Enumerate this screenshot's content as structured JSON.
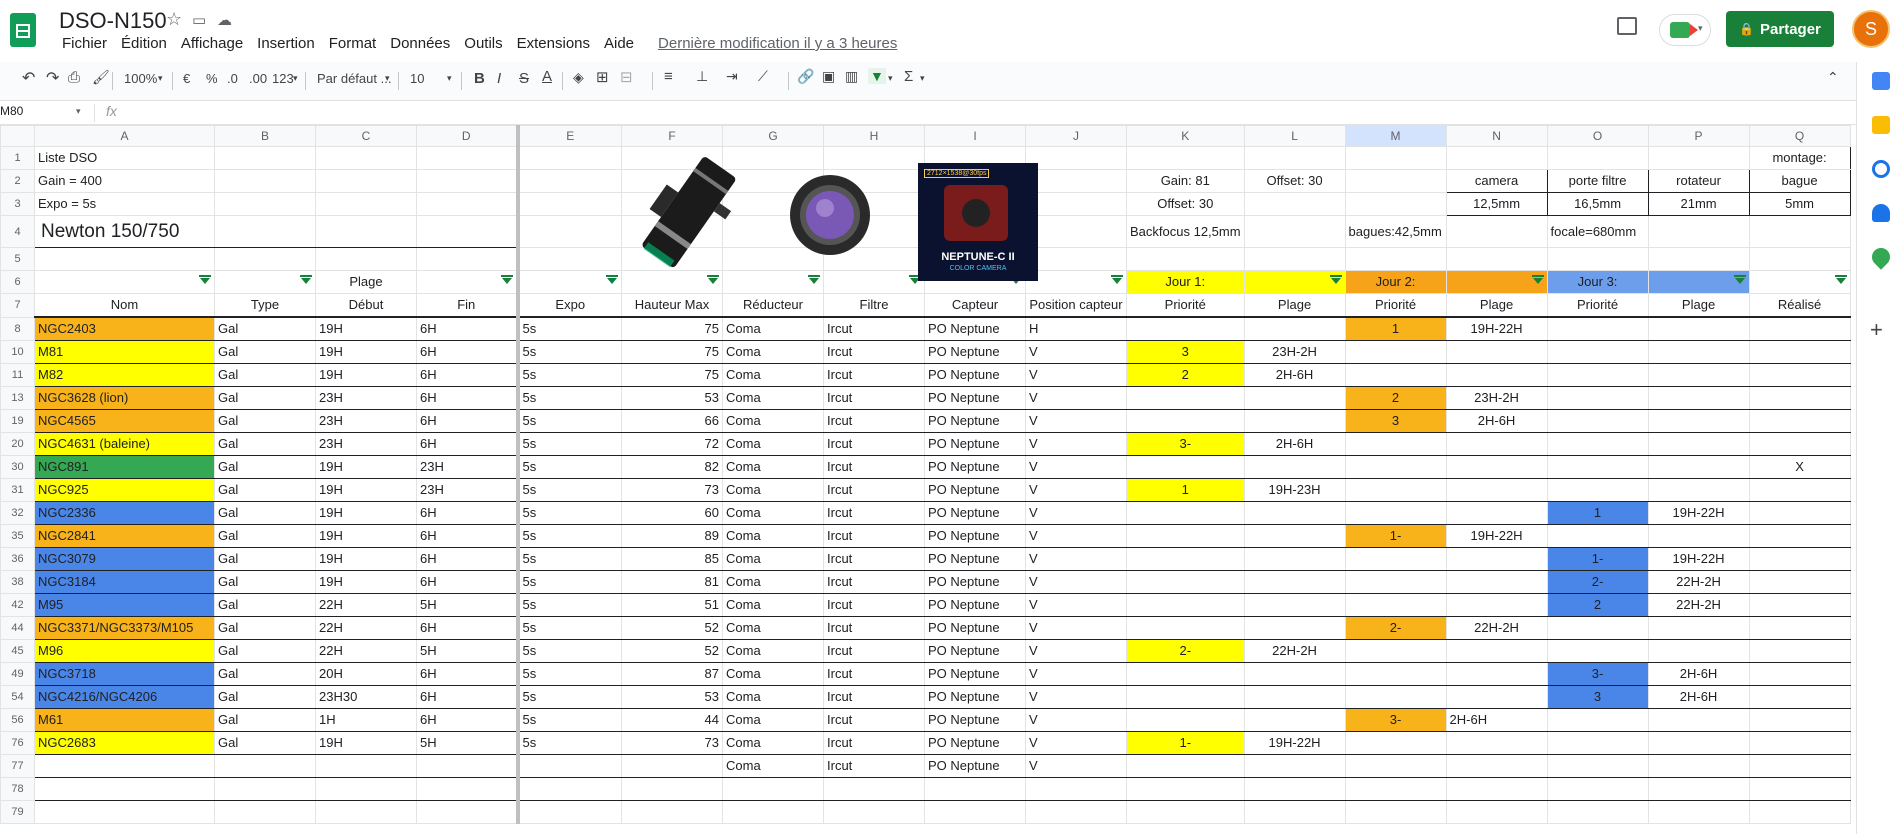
{
  "doc": {
    "title": "DSO-N150",
    "menus": [
      "Fichier",
      "Édition",
      "Affichage",
      "Insertion",
      "Format",
      "Données",
      "Outils",
      "Extensions",
      "Aide"
    ],
    "last_edit": "Dernière modification il y a 3 heures",
    "share_label": "Partager",
    "avatar_letter": "S"
  },
  "toolbar": {
    "zoom": "100%",
    "currency": "€",
    "percent": "%",
    "dec_less": ".0",
    "dec_more": ".00",
    "number_format": "123",
    "font": "Par défaut ...",
    "font_size": "10"
  },
  "formula": {
    "cell_ref": "M80",
    "fx": "fx"
  },
  "colors": {
    "brand": "#188038",
    "yellow": "#ffff00",
    "orange": "#f9b31a",
    "green": "#34a853",
    "blue": "#4a86e8"
  },
  "columns": [
    "A",
    "B",
    "C",
    "D",
    "E",
    "F",
    "G",
    "H",
    "I",
    "J",
    "K",
    "L",
    "M",
    "N",
    "O",
    "P",
    "Q"
  ],
  "header_rows": {
    "r1_a": "Liste DSO",
    "r1_q": "montage:",
    "r2_a": "Gain = 400",
    "r2_k": "Gain: 81",
    "r2_l": "Offset: 30",
    "r2_n": "camera",
    "r2_o": "porte filtre",
    "r2_p": "rotateur",
    "r2_q": "bague",
    "r3_a": "Expo = 5s",
    "r3_k": "Offset: 30",
    "r3_n": "12,5mm",
    "r3_o": "16,5mm",
    "r3_p": "21mm",
    "r3_q": "5mm",
    "r4_a": "Newton 150/750",
    "r4_k": "Backfocus 12,5mm",
    "r4_m": "bagues:42,5mm",
    "r4_o": "focale=680mm",
    "r6_c": "Plage",
    "r6_k": "Jour 1:",
    "r6_m": "Jour 2:",
    "r6_o": "Jour 3:",
    "r7": [
      "Nom",
      "Type",
      "Début",
      "Fin",
      "Expo",
      "Hauteur Max",
      "Réducteur",
      "Filtre",
      "Capteur",
      "Position capteur",
      "Priorité",
      "Plage",
      "Priorité",
      "Plage",
      "Priorité",
      "Plage",
      "Réalisé"
    ]
  },
  "rows": [
    {
      "n": "8",
      "name": "NGC2403",
      "type": "Gal",
      "start": "19H",
      "end": "6H",
      "expo": "5s",
      "hmax": "75",
      "red": "Coma",
      "filter": "Ircut",
      "cap": "PO Neptune",
      "pos": "H",
      "p1": "",
      "r1": "",
      "p2": "1",
      "r2": "19H-22H",
      "p3": "",
      "r3": "",
      "done": ""
    },
    {
      "n": "10",
      "name": "M81",
      "type": "Gal",
      "start": "19H",
      "end": "6H",
      "expo": "5s",
      "hmax": "75",
      "red": "Coma",
      "filter": "Ircut",
      "cap": "PO Neptune",
      "pos": "V",
      "p1": "3",
      "r1": "23H-2H",
      "p2": "",
      "r2": "",
      "p3": "",
      "r3": "",
      "done": ""
    },
    {
      "n": "11",
      "name": "M82",
      "type": "Gal",
      "start": "19H",
      "end": "6H",
      "expo": "5s",
      "hmax": "75",
      "red": "Coma",
      "filter": "Ircut",
      "cap": "PO Neptune",
      "pos": "V",
      "p1": "2",
      "r1": "2H-6H",
      "p2": "",
      "r2": "",
      "p3": "",
      "r3": "",
      "done": ""
    },
    {
      "n": "13",
      "name": "NGC3628 (lion)",
      "type": "Gal",
      "start": "23H",
      "end": "6H",
      "expo": "5s",
      "hmax": "53",
      "red": "Coma",
      "filter": "Ircut",
      "cap": "PO Neptune",
      "pos": "V",
      "p1": "",
      "r1": "",
      "p2": "2",
      "r2": "23H-2H",
      "p3": "",
      "r3": "",
      "done": ""
    },
    {
      "n": "19",
      "name": "NGC4565",
      "type": "Gal",
      "start": "23H",
      "end": "6H",
      "expo": "5s",
      "hmax": "66",
      "red": "Coma",
      "filter": "Ircut",
      "cap": "PO Neptune",
      "pos": "V",
      "p1": "",
      "r1": "",
      "p2": "3",
      "r2": "2H-6H",
      "p3": "",
      "r3": "",
      "done": ""
    },
    {
      "n": "20",
      "name": "NGC4631 (baleine)",
      "type": "Gal",
      "start": "23H",
      "end": "6H",
      "expo": "5s",
      "hmax": "72",
      "red": "Coma",
      "filter": "Ircut",
      "cap": "PO Neptune",
      "pos": "V",
      "p1": "3-",
      "r1": "2H-6H",
      "p2": "",
      "r2": "",
      "p3": "",
      "r3": "",
      "done": ""
    },
    {
      "n": "30",
      "name": "NGC891",
      "type": "Gal",
      "start": "19H",
      "end": "23H",
      "expo": "5s",
      "hmax": "82",
      "red": "Coma",
      "filter": "Ircut",
      "cap": "PO Neptune",
      "pos": "V",
      "p1": "",
      "r1": "",
      "p2": "",
      "r2": "",
      "p3": "",
      "r3": "",
      "done": "X"
    },
    {
      "n": "31",
      "name": "NGC925",
      "type": "Gal",
      "start": "19H",
      "end": "23H",
      "expo": "5s",
      "hmax": "73",
      "red": "Coma",
      "filter": "Ircut",
      "cap": "PO Neptune",
      "pos": "V",
      "p1": "1",
      "r1": "19H-23H",
      "p2": "",
      "r2": "",
      "p3": "",
      "r3": "",
      "done": ""
    },
    {
      "n": "32",
      "name": "NGC2336",
      "type": "Gal",
      "start": "19H",
      "end": "6H",
      "expo": "5s",
      "hmax": "60",
      "red": "Coma",
      "filter": "Ircut",
      "cap": "PO Neptune",
      "pos": "V",
      "p1": "",
      "r1": "",
      "p2": "",
      "r2": "",
      "p3": "1",
      "r3": "19H-22H",
      "done": ""
    },
    {
      "n": "35",
      "name": "NGC2841",
      "type": "Gal",
      "start": "19H",
      "end": "6H",
      "expo": "5s",
      "hmax": "89",
      "red": "Coma",
      "filter": "Ircut",
      "cap": "PO Neptune",
      "pos": "V",
      "p1": "",
      "r1": "",
      "p2": "1-",
      "r2": "19H-22H",
      "p3": "",
      "r3": "",
      "done": ""
    },
    {
      "n": "36",
      "name": "NGC3079",
      "type": "Gal",
      "start": "19H",
      "end": "6H",
      "expo": "5s",
      "hmax": "85",
      "red": "Coma",
      "filter": "Ircut",
      "cap": "PO Neptune",
      "pos": "V",
      "p1": "",
      "r1": "",
      "p2": "",
      "r2": "",
      "p3": "1-",
      "r3": "19H-22H",
      "done": ""
    },
    {
      "n": "38",
      "name": "NGC3184",
      "type": "Gal",
      "start": "19H",
      "end": "6H",
      "expo": "5s",
      "hmax": "81",
      "red": "Coma",
      "filter": "Ircut",
      "cap": "PO Neptune",
      "pos": "V",
      "p1": "",
      "r1": "",
      "p2": "",
      "r2": "",
      "p3": "2-",
      "r3": "22H-2H",
      "done": ""
    },
    {
      "n": "42",
      "name": "M95",
      "type": "Gal",
      "start": "22H",
      "end": "5H",
      "expo": "5s",
      "hmax": "51",
      "red": "Coma",
      "filter": "Ircut",
      "cap": "PO Neptune",
      "pos": "V",
      "p1": "",
      "r1": "",
      "p2": "",
      "r2": "",
      "p3": "2",
      "r3": "22H-2H",
      "done": ""
    },
    {
      "n": "44",
      "name": "NGC3371/NGC3373/M105",
      "type": "Gal",
      "start": "22H",
      "end": "6H",
      "expo": "5s",
      "hmax": "52",
      "red": "Coma",
      "filter": "Ircut",
      "cap": "PO Neptune",
      "pos": "V",
      "p1": "",
      "r1": "",
      "p2": "2-",
      "r2": "22H-2H",
      "p3": "",
      "r3": "",
      "done": ""
    },
    {
      "n": "45",
      "name": "M96",
      "type": "Gal",
      "start": "22H",
      "end": "5H",
      "expo": "5s",
      "hmax": "52",
      "red": "Coma",
      "filter": "Ircut",
      "cap": "PO Neptune",
      "pos": "V",
      "p1": "2-",
      "r1": "22H-2H",
      "p2": "",
      "r2": "",
      "p3": "",
      "r3": "",
      "done": ""
    },
    {
      "n": "49",
      "name": "NGC3718",
      "type": "Gal",
      "start": "20H",
      "end": "6H",
      "expo": "5s",
      "hmax": "87",
      "red": "Coma",
      "filter": "Ircut",
      "cap": "PO Neptune",
      "pos": "V",
      "p1": "",
      "r1": "",
      "p2": "",
      "r2": "",
      "p3": "3-",
      "r3": "2H-6H",
      "done": ""
    },
    {
      "n": "54",
      "name": "NGC4216/NGC4206",
      "type": "Gal",
      "start": "23H30",
      "end": "6H",
      "expo": "5s",
      "hmax": "53",
      "red": "Coma",
      "filter": "Ircut",
      "cap": "PO Neptune",
      "pos": "V",
      "p1": "",
      "r1": "",
      "p2": "",
      "r2": "",
      "p3": "3",
      "r3": "2H-6H",
      "done": ""
    },
    {
      "n": "56",
      "name": "M61",
      "type": "Gal",
      "start": "1H",
      "end": "6H",
      "expo": "5s",
      "hmax": "44",
      "red": "Coma",
      "filter": "Ircut",
      "cap": "PO Neptune",
      "pos": "V",
      "p1": "",
      "r1": "",
      "p2": "3-",
      "r2": "2H-6H",
      "p3": "",
      "r3": "",
      "done": ""
    },
    {
      "n": "76",
      "name": "NGC2683",
      "type": "Gal",
      "start": "19H",
      "end": "5H",
      "expo": "5s",
      "hmax": "73",
      "red": "Coma",
      "filter": "Ircut",
      "cap": "PO Neptune",
      "pos": "V",
      "p1": "1-",
      "r1": "19H-22H",
      "p2": "",
      "r2": "",
      "p3": "",
      "r3": "",
      "done": ""
    },
    {
      "n": "77",
      "name": "",
      "type": "",
      "start": "",
      "end": "",
      "expo": "",
      "hmax": "",
      "red": "Coma",
      "filter": "Ircut",
      "cap": "PO Neptune",
      "pos": "V",
      "p1": "",
      "r1": "",
      "p2": "",
      "r2": "",
      "p3": "",
      "r3": "",
      "done": ""
    }
  ],
  "name_colors": [
    "orange",
    "yellow",
    "yellow",
    "orange",
    "orange",
    "yellow",
    "green",
    "yellow",
    "blue",
    "orange",
    "blue",
    "blue",
    "blue",
    "orange",
    "yellow",
    "blue",
    "blue",
    "orange",
    "yellow",
    ""
  ],
  "images": {
    "camera_label": "NEPTUNE-C II",
    "camera_sub": "COLOR CAMERA",
    "camera_badge": "2712×1538@30fps"
  }
}
